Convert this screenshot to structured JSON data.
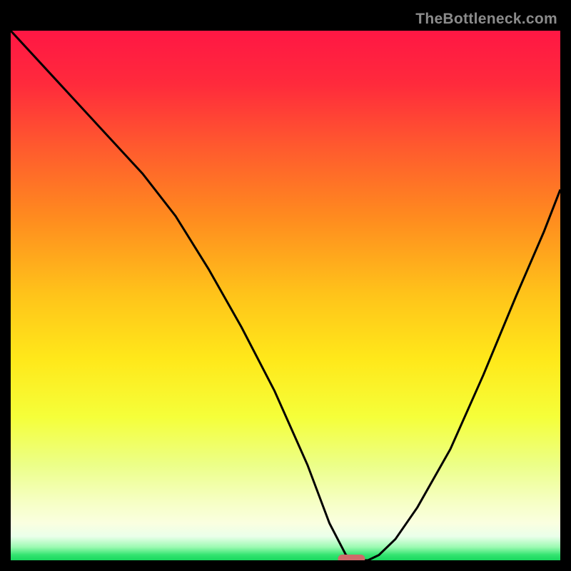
{
  "watermark": "TheBottleneck.com",
  "colors": {
    "background": "#000000",
    "watermark": "#8b8b8b",
    "line": "#000000",
    "marker": "#cf6a6a",
    "gradient_stops": [
      {
        "offset": 0.0,
        "color": "#ff1744"
      },
      {
        "offset": 0.1,
        "color": "#ff2a3c"
      },
      {
        "offset": 0.22,
        "color": "#ff5a2e"
      },
      {
        "offset": 0.35,
        "color": "#ff8a1f"
      },
      {
        "offset": 0.5,
        "color": "#ffc41a"
      },
      {
        "offset": 0.62,
        "color": "#ffe81a"
      },
      {
        "offset": 0.73,
        "color": "#f5ff3a"
      },
      {
        "offset": 0.82,
        "color": "#ecff88"
      },
      {
        "offset": 0.89,
        "color": "#f6ffc4"
      },
      {
        "offset": 0.93,
        "color": "#faffe0"
      },
      {
        "offset": 0.955,
        "color": "#eaffea"
      },
      {
        "offset": 0.975,
        "color": "#9cfab2"
      },
      {
        "offset": 0.99,
        "color": "#33e46f"
      },
      {
        "offset": 1.0,
        "color": "#19d85f"
      }
    ]
  },
  "chart_data": {
    "type": "line",
    "title": "",
    "xlabel": "",
    "ylabel": "",
    "xlim": [
      0,
      100
    ],
    "ylim": [
      0,
      100
    ],
    "legend": false,
    "grid": false,
    "marker": {
      "x": 62,
      "y": 0,
      "shape": "pill"
    },
    "series": [
      {
        "name": "curve",
        "x": [
          0,
          8,
          16,
          24,
          30,
          36,
          42,
          48,
          54,
          58,
          61,
          63,
          65,
          67,
          70,
          74,
          80,
          86,
          92,
          97,
          100
        ],
        "y": [
          100,
          91,
          82,
          73,
          65,
          55,
          44,
          32,
          18,
          7,
          1,
          0,
          0,
          1,
          4,
          10,
          21,
          35,
          50,
          62,
          70
        ]
      }
    ]
  }
}
